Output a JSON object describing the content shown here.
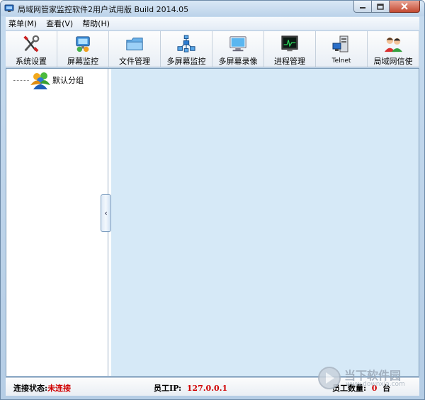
{
  "window": {
    "title": "局域网管家监控软件2用户试用版  Build 2014.05"
  },
  "menu": [
    {
      "label": "菜单(M)"
    },
    {
      "label": "查看(V)"
    },
    {
      "label": "帮助(H)"
    }
  ],
  "toolbar": [
    {
      "label": "系统设置",
      "icon": "tools-icon"
    },
    {
      "label": "屏幕监控",
      "icon": "screen-monitor-icon"
    },
    {
      "label": "文件管理",
      "icon": "folder-icon"
    },
    {
      "label": "多屏幕监控",
      "icon": "network-icon"
    },
    {
      "label": "多屏幕录像",
      "icon": "monitor-icon"
    },
    {
      "label": "进程管理",
      "icon": "process-icon"
    },
    {
      "label": "Telnet",
      "icon": "server-icon"
    },
    {
      "label": "局域网信使",
      "icon": "users-chat-icon"
    }
  ],
  "tree": {
    "root_label": "默认分组"
  },
  "collapse_glyph": "‹",
  "status": {
    "connection_label": "连接状态:",
    "connection_value": "未连接",
    "ip_label": "员工IP:",
    "ip_value": "127.0.0.1",
    "count_label": "员工数量:",
    "count_value": "0",
    "count_unit": "台"
  },
  "watermark": {
    "text": "当下软件园",
    "url": "www.downxia.com"
  },
  "colors": {
    "status_value": "#d00000",
    "main_pane": "#d6e9f7"
  }
}
